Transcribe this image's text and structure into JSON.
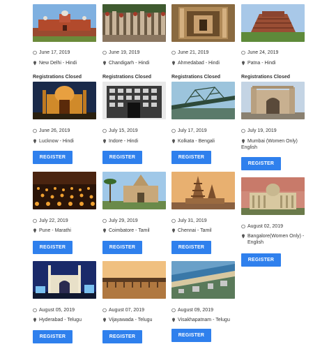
{
  "registration_closed_label": "Registrations Closed",
  "register_label": "REGISTER",
  "colors": {
    "button": "#2f80ed",
    "text": "#333333"
  },
  "events": [
    {
      "date": "June 17, 2019",
      "location": "New Delhi - Hindi",
      "status": "closed",
      "image": "red-fort"
    },
    {
      "date": "June 19, 2019",
      "location": "Chandigarh - Hindi",
      "status": "closed",
      "image": "rock-garden"
    },
    {
      "date": "June 21, 2019",
      "location": "Ahmedabad - Hindi",
      "status": "closed",
      "image": "stepwell"
    },
    {
      "date": "June 24, 2019",
      "location": "Patna - Hindi",
      "status": "closed",
      "image": "nalanda-ruins"
    },
    {
      "date": "June 26, 2019",
      "location": "Lucknow - Hindi",
      "status": "register",
      "image": "lucknow-gate"
    },
    {
      "date": "July 15, 2019",
      "location": "Indore - Hindi",
      "status": "register",
      "image": "rajwada"
    },
    {
      "date": "July 17, 2019",
      "location": "Kolkata - Bengali",
      "status": "register",
      "image": "howrah-bridge"
    },
    {
      "date": "July 19, 2019",
      "location": "Mumbai (Women Only) English",
      "status": "register",
      "image": "gateway-of-india"
    },
    {
      "date": "July 22, 2019",
      "location": "Pune - Marathi",
      "status": "register",
      "image": "lamps-festival"
    },
    {
      "date": "July 29, 2019",
      "location": "Coimbatore - Tamil",
      "status": "register",
      "image": "temple-palms"
    },
    {
      "date": "July 31, 2019",
      "location": "Chennai - Tamil",
      "status": "register",
      "image": "shore-temple"
    },
    {
      "date": "August 02, 2019",
      "location": "Bangalore(Women Only) - English",
      "status": "register",
      "image": "vidhana-soudha"
    },
    {
      "date": "August 05, 2019",
      "location": "Hyderabad - Telugu",
      "status": "register",
      "image": "charminar"
    },
    {
      "date": "August 07, 2019",
      "location": "Vijayawada - Telugu",
      "status": "register",
      "image": "barrage"
    },
    {
      "date": "August 09, 2019",
      "location": "Visakhapatnam - Telugu",
      "status": "register",
      "image": "beach-road"
    }
  ]
}
